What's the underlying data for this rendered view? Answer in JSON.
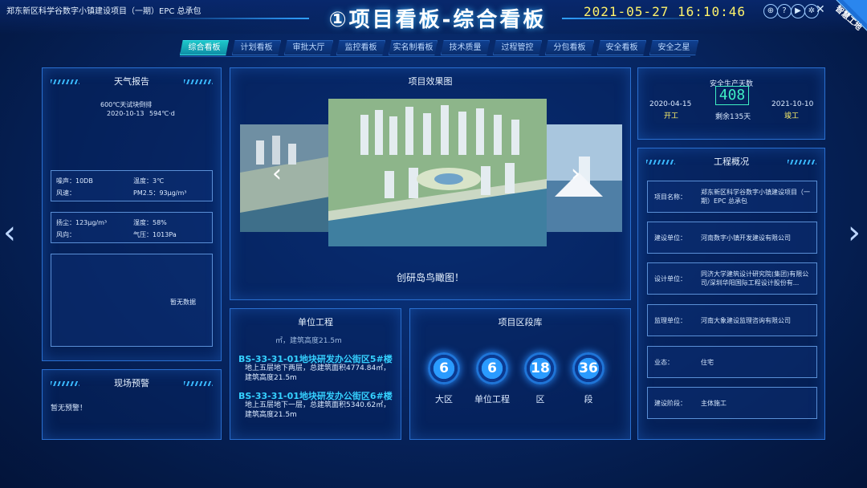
{
  "header": {
    "project_name": "郑东新区科学谷数字小镇建设项目（一期）EPC 总承包",
    "title": "①项目看板-综合看板",
    "datetime": "2021-05-27  16:10:46",
    "controls": [
      "fullscreen-icon",
      "help-icon",
      "play-icon",
      "settings-icon",
      "collapse-icon"
    ],
    "badge": "智慧工地"
  },
  "tabs": [
    "综合看板",
    "计划看板",
    "审批大厅",
    "监控看板",
    "实名制看板",
    "技术质量",
    "过程管控",
    "分包看板",
    "安全看板",
    "安全之星"
  ],
  "weather": {
    "title": "天气报告",
    "note_line1": "600℃天试块倒排",
    "note_date": "2020-10-13",
    "note_value": "594℃·d",
    "noise_label": "噪声：10DB",
    "temp_label": "温度：3℃",
    "wind_label": "风速：",
    "pm25_label": "PM2.5：93μg/m³",
    "pm10_label": "扬尘：123μg/m³",
    "humidity_label": "湿度：58%",
    "wind_dir_label": "风向：",
    "pressure_label": "气压：1013Pa",
    "empty": "暂无数据"
  },
  "alert": {
    "title": "现场预警",
    "content": "暂无预警！"
  },
  "effect": {
    "title": "项目效果图",
    "caption": "创研岛鸟瞰图！"
  },
  "units": {
    "title": "单位工程",
    "partial_line": "㎡，建筑高度21.5m",
    "items": [
      {
        "name": "BS-33-31-01地块研发办公街区5#楼",
        "desc": "地上五层地下两层，总建筑面积4774.84㎡，建筑高度21.5m"
      },
      {
        "name": "BS-33-31-01地块研发办公街区6#楼",
        "desc": "地上五层地下一层，总建筑面积5340.62㎡，建筑高度21.5m"
      }
    ]
  },
  "sections": {
    "title": "项目区段库",
    "items": [
      {
        "value": "6",
        "label": "大区"
      },
      {
        "value": "6",
        "label": "单位工程"
      },
      {
        "value": "18",
        "label": "区"
      },
      {
        "value": "36",
        "label": "段"
      }
    ]
  },
  "safety": {
    "title": "安全生产天数",
    "days": "408",
    "start_date": "2020-04-15",
    "start_label": "开工",
    "remaining": "剩余135天",
    "end_date": "2021-10-10",
    "end_label": "竣工"
  },
  "overview": {
    "title": "工程概况",
    "rows": [
      {
        "label": "项目名称：",
        "value": "郑东新区科学谷数字小镇建设项目（一期）EPC 总承包"
      },
      {
        "label": "建设单位：",
        "value": "河南数字小镇开发建设有限公司"
      },
      {
        "label": "设计单位：",
        "value": "同济大学建筑设计研究院(集团)有限公司/深圳华阳国际工程设计股份有..."
      },
      {
        "label": "监理单位：",
        "value": "河南大象建设监理咨询有限公司"
      },
      {
        "label": "业态：",
        "value": "住宅"
      },
      {
        "label": "建设阶段：",
        "value": "主体施工"
      }
    ]
  },
  "colors": {
    "accent": "#35d1ff",
    "highlight": "#fff36b",
    "tab_active": "#1dc6c9"
  }
}
